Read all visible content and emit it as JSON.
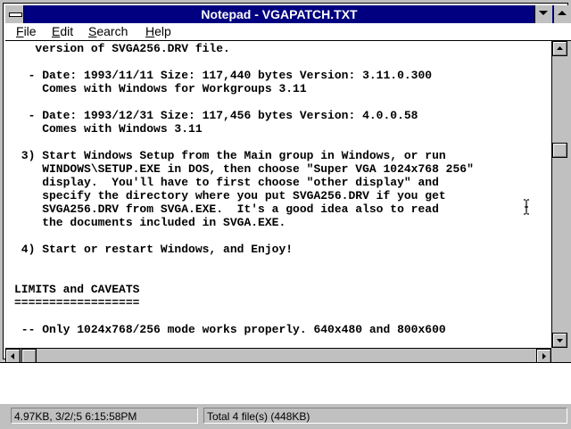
{
  "window": {
    "title": "Notepad - VGAPATCH.TXT"
  },
  "menu": [
    {
      "label": "File",
      "accel": "F",
      "rest": "ile"
    },
    {
      "label": "Edit",
      "accel": "E",
      "rest": "dit"
    },
    {
      "label": "Search",
      "accel": "S",
      "rest": "earch"
    },
    {
      "label": "Help",
      "accel": "H",
      "rest": "elp"
    }
  ],
  "document": {
    "lines": [
      "   version of SVGA256.DRV file.",
      "",
      "  - Date: 1993/11/11 Size: 117,440 bytes Version: 3.11.0.300",
      "    Comes with Windows for Workgroups 3.11",
      "",
      "  - Date: 1993/12/31 Size: 117,456 bytes Version: 4.0.0.58",
      "    Comes with Windows 3.11",
      "",
      " 3) Start Windows Setup from the Main group in Windows, or run",
      "    WINDOWS\\SETUP.EXE in DOS, then choose \"Super VGA 1024x768 256\"",
      "    display.  You'll have to first choose \"other display\" and",
      "    specify the directory where you put SVGA256.DRV if you get",
      "    SVGA256.DRV from SVGA.EXE.  It's a good idea also to read",
      "    the documents included in SVGA.EXE.",
      "",
      " 4) Start or restart Windows, and Enjoy!",
      "",
      "",
      "LIMITS and CAVEATS",
      "==================",
      "",
      " -- Only 1024x768/256 mode works properly. 640x480 and 800x600"
    ]
  },
  "status": {
    "left": "4.97KB, 3/2/;5 6:15:58PM",
    "right": "Total 4 file(s) (448KB)"
  },
  "icons": [
    "system-menu-icon",
    "minimize-icon",
    "maximize-icon",
    "scroll-up-icon",
    "scroll-down-icon",
    "scroll-left-icon",
    "scroll-right-icon",
    "ibeam-cursor-icon"
  ]
}
